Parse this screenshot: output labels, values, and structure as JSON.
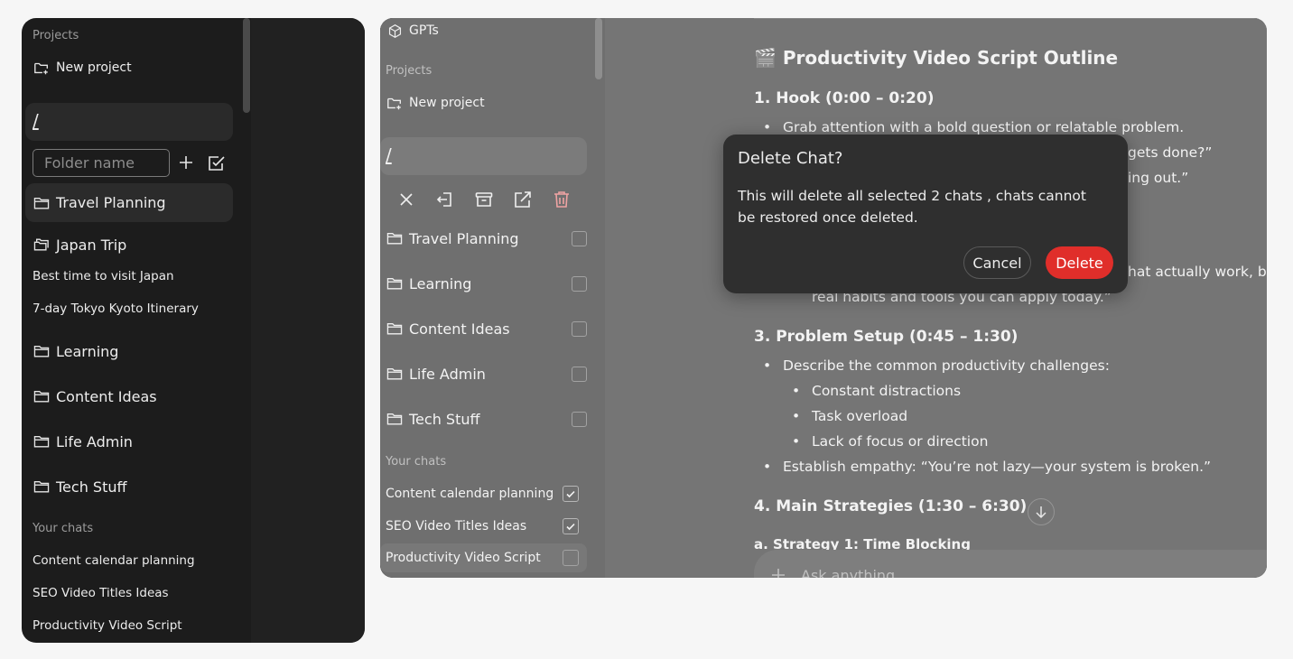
{
  "left_panel": {
    "projects_label": "Projects",
    "new_project_label": "New project",
    "slash_text": "/",
    "folder_name_placeholder": "Folder name",
    "folders": [
      {
        "label": "Travel Planning"
      },
      {
        "label": "Japan Trip"
      },
      {
        "label": "Learning"
      },
      {
        "label": "Content Ideas"
      },
      {
        "label": "Life Admin"
      },
      {
        "label": "Tech Stuff"
      }
    ],
    "folder_chats": [
      "Best time to visit Japan",
      "7-day Tokyo Kyoto Itinerary"
    ],
    "your_chats_label": "Your chats",
    "chats": [
      "Content calendar planning",
      "SEO Video Titles Ideas",
      "Productivity Video Script"
    ]
  },
  "right_panel": {
    "gpts_label": "GPTs",
    "projects_label": "Projects",
    "new_project_label": "New project",
    "slash_text": "/",
    "folders": [
      {
        "label": "Travel Planning"
      },
      {
        "label": "Learning"
      },
      {
        "label": "Content Ideas"
      },
      {
        "label": "Life Admin"
      },
      {
        "label": "Tech Stuff"
      }
    ],
    "your_chats_label": "Your chats",
    "chats": [
      {
        "label": "Content calendar planning",
        "checked": true
      },
      {
        "label": "SEO Video Titles Ideas",
        "checked": true
      },
      {
        "label": "Productivity Video Script",
        "checked": false
      }
    ],
    "doc": {
      "title": "🎬 Productivity Video Script Outline",
      "hook_heading": "1. Hook (0:00 – 0:20)",
      "hook_bullet": "Grab attention with a bold question or relatable problem.",
      "frag_gets_done": "gets done?”",
      "frag_ing_out": "ing out.”",
      "frag_actually_work": "hat actually work, bac",
      "frag_real_habits": "real habits and tools you can apply today.”",
      "problem_heading": "3. Problem Setup (0:45 – 1:30)",
      "problem_bullet": "Describe the common productivity challenges:",
      "problem_subs": [
        "Constant distractions",
        "Task overload",
        "Lack of focus or direction"
      ],
      "empathy_bullet": "Establish empathy: “You’re not lazy—your system is broken.”",
      "strategies_heading": "4. Main Strategies (1:30 – 6:30)",
      "strategy1_heading": "a. Strategy 1: Time Blocking"
    },
    "composer_placeholder": "Ask anything"
  },
  "modal": {
    "title": "Delete Chat?",
    "body": "This will delete all selected 2 chats , chats cannot be restored once deleted.",
    "cancel_label": "Cancel",
    "delete_label": "Delete"
  },
  "colors": {
    "delete_red": "#e02e2a",
    "trash_icon": "#e56b6b"
  }
}
